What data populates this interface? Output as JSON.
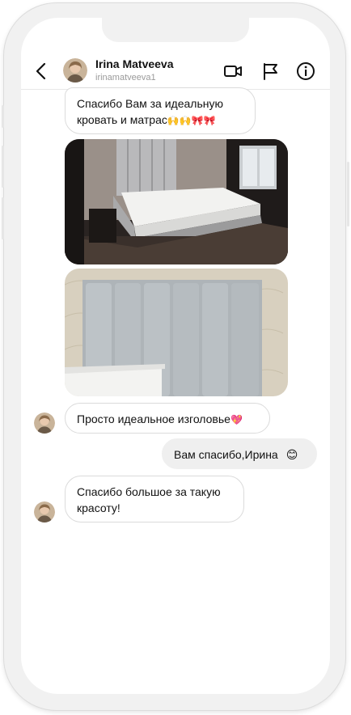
{
  "header": {
    "name": "Irina Matveeva",
    "username": "irinamatveeva1"
  },
  "icons": {
    "back": "chevron-left-icon",
    "video": "video-camera-icon",
    "report": "flag-icon",
    "info": "info-icon"
  },
  "messages": [
    {
      "id": "m1",
      "direction": "incoming",
      "text": "Спасибо Вам за идеальную кровать и матрас",
      "emoji": "🙌🙌🎀🎀"
    },
    {
      "id": "m2",
      "direction": "incoming",
      "type": "photo",
      "subject": "bed-with-mattress"
    },
    {
      "id": "m3",
      "direction": "incoming",
      "type": "photo",
      "subject": "headboard-closeup"
    },
    {
      "id": "m4",
      "direction": "incoming",
      "text": "Просто идеальное изголовье",
      "emoji": "💖"
    },
    {
      "id": "m5",
      "direction": "outgoing",
      "text": "Вам спасибо,Ирина",
      "emoji": "😊"
    },
    {
      "id": "m6",
      "direction": "incoming",
      "text_line1": "Спасибо большое за такую",
      "text_line2": "красоту!"
    }
  ],
  "colors": {
    "incoming_bubble": "#ffffff",
    "incoming_border": "#dbdbdb",
    "outgoing_bubble": "#efefef",
    "phone_frame": "#f1f1f1",
    "muted_text": "#9a9a9a"
  }
}
